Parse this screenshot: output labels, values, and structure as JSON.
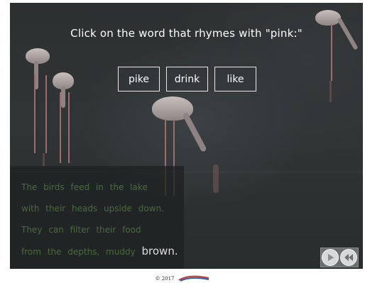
{
  "activity": {
    "prompt": "Click on the word that rhymes with \"pink:\"",
    "choices": [
      "pike",
      "drink",
      "like"
    ]
  },
  "poem": {
    "lines": [
      "The birds feed in the lake",
      "with their heads upside down.",
      "They can filter their food",
      "from the depths, muddy"
    ],
    "highlight_word": "brown."
  },
  "controls": {
    "play": "play-icon",
    "rewind": "rewind-icon"
  },
  "footer": {
    "copyright": "© 2017",
    "logo": "publisher-logo-icon"
  },
  "colors": {
    "poem_text": "#4b6a3b",
    "highlight": "#dcdcdc",
    "stage_bg": "#2f3435"
  }
}
